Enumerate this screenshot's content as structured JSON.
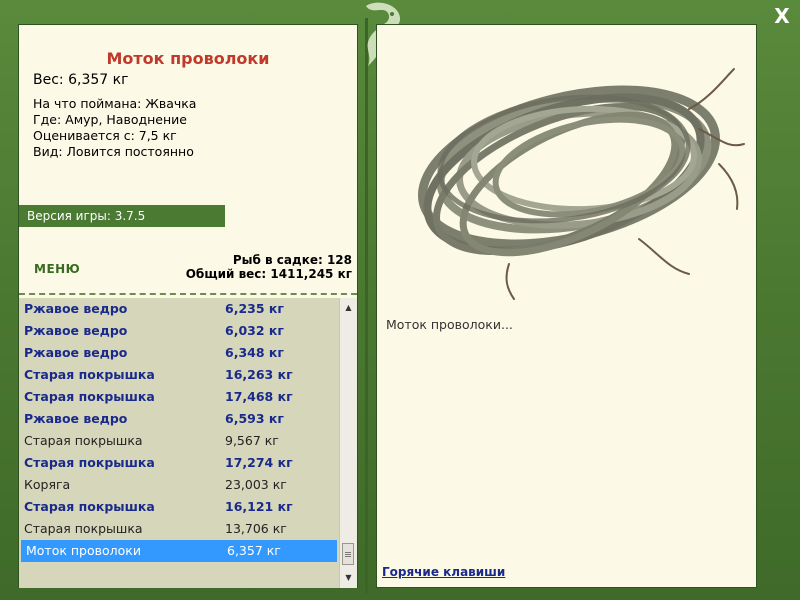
{
  "fish": {
    "name": "Моток проволоки",
    "weight": "Вес: 6,357 кг",
    "caught_on": "На что поймана: Жвачка",
    "where": "Где: Амур, Наводнение",
    "rated_from": "Оценивается с: 7,5 кг",
    "kind": "Вид: Ловится постоянно",
    "description": "Моток проволоки..."
  },
  "version": "Версия игры: 3.7.5",
  "menu_label": "МЕНЮ",
  "stats": {
    "fish_in_cage": "Рыб в садке: 128",
    "total_weight": "Общий вес: 1411,245 кг"
  },
  "catch_list": [
    {
      "name": "Ржавое ведро",
      "weight": "6,235 кг",
      "style": "bold"
    },
    {
      "name": "Ржавое ведро",
      "weight": "6,032 кг",
      "style": "bold"
    },
    {
      "name": "Ржавое ведро",
      "weight": "6,348 кг",
      "style": "bold"
    },
    {
      "name": "Старая покрышка",
      "weight": "16,263 кг",
      "style": "bold"
    },
    {
      "name": "Старая покрышка",
      "weight": "17,468 кг",
      "style": "bold"
    },
    {
      "name": "Ржавое ведро",
      "weight": "6,593 кг",
      "style": "bold"
    },
    {
      "name": "Старая покрышка",
      "weight": "9,567 кг",
      "style": "normal"
    },
    {
      "name": "Старая покрышка",
      "weight": "17,274 кг",
      "style": "bold"
    },
    {
      "name": "Коряга",
      "weight": "23,003 кг",
      "style": "normal"
    },
    {
      "name": "Старая покрышка",
      "weight": "16,121 кг",
      "style": "bold"
    },
    {
      "name": "Старая покрышка",
      "weight": "13,706 кг",
      "style": "normal"
    },
    {
      "name": "Моток проволоки",
      "weight": "6,357 кг",
      "style": "selected"
    }
  ],
  "hotkeys_label": "Горячие клавиши",
  "close_label": "X",
  "icons": {
    "close": "close-icon",
    "logo": "lizard-logo-icon",
    "scroll_up": "scroll-up-icon",
    "scroll_down": "scroll-down-icon"
  },
  "colors": {
    "frame_green": "#4e7a34",
    "panel_bg": "#fcf9e6",
    "title_red": "#c0392b",
    "bold_blue": "#1a2a8c",
    "selection": "#3399ff",
    "list_bg": "#d6d7ba"
  }
}
